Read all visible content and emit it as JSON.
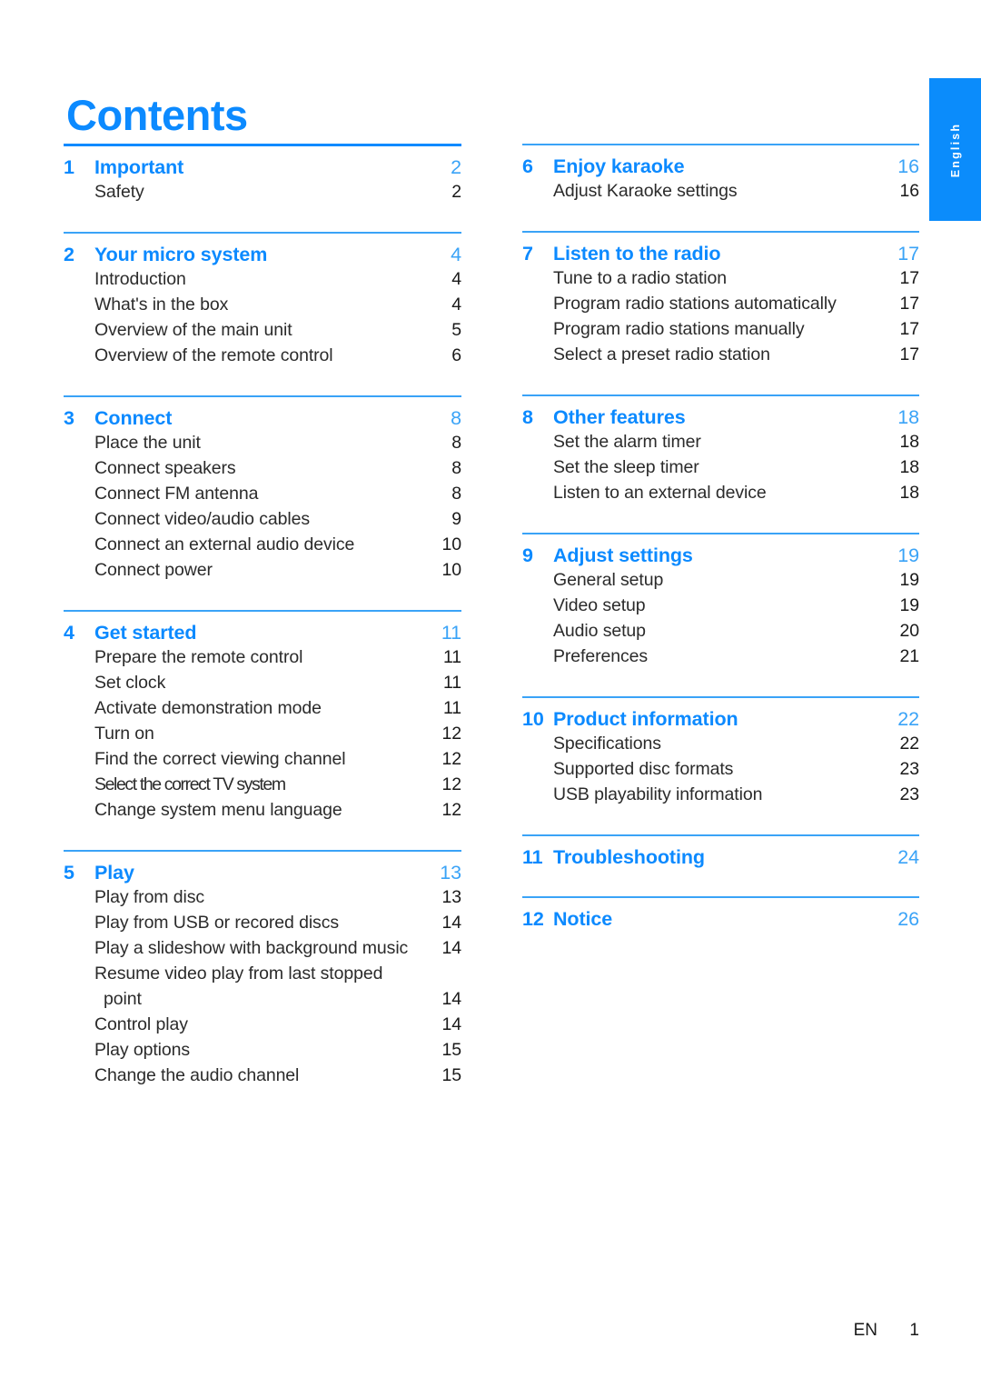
{
  "page": {
    "title": "Contents",
    "language_tab": "English",
    "footer": {
      "locale": "EN",
      "page_number": "1"
    },
    "accent_color": "#0c8aff",
    "rule_color": "#3aa3f7",
    "text_color": "#2b2b2b"
  },
  "columns": [
    {
      "sections": [
        {
          "number": "1",
          "title": "Important",
          "page": "2",
          "rule": "thick",
          "entries": [
            {
              "label": "Safety",
              "page": "2"
            }
          ]
        },
        {
          "number": "2",
          "title": "Your micro system",
          "page": "4",
          "rule": "thin",
          "entries": [
            {
              "label": "Introduction",
              "page": "4"
            },
            {
              "label": "What's in the box",
              "page": "4"
            },
            {
              "label": "Overview of the main unit",
              "page": "5"
            },
            {
              "label": "Overview of the remote control",
              "page": "6"
            }
          ]
        },
        {
          "number": "3",
          "title": "Connect",
          "page": "8",
          "rule": "thin",
          "entries": [
            {
              "label": "Place the unit",
              "page": "8"
            },
            {
              "label": "Connect speakers",
              "page": "8"
            },
            {
              "label": "Connect FM antenna",
              "page": "8"
            },
            {
              "label": "Connect video/audio cables",
              "page": "9"
            },
            {
              "label": "Connect an external audio device",
              "page": "10"
            },
            {
              "label": "Connect power",
              "page": "10"
            }
          ]
        },
        {
          "number": "4",
          "title": "Get started",
          "page": "11",
          "rule": "thin",
          "entries": [
            {
              "label": "Prepare the remote control",
              "page": "11"
            },
            {
              "label": "Set clock",
              "page": "11"
            },
            {
              "label": "Activate demonstration mode",
              "page": "11"
            },
            {
              "label": "Turn on",
              "page": "12"
            },
            {
              "label": "Find the correct viewing channel",
              "page": "12"
            },
            {
              "label": "Select the correct TV system",
              "page": "12",
              "tight": true
            },
            {
              "label": "Change system menu language",
              "page": "12"
            }
          ]
        },
        {
          "number": "5",
          "title": "Play",
          "page": "13",
          "rule": "thin",
          "entries": [
            {
              "label": "Play from disc",
              "page": "13"
            },
            {
              "label": "Play from USB or recored discs",
              "page": "14"
            },
            {
              "label": "Play a slideshow with background music",
              "page": "14"
            },
            {
              "label": "Resume video play from last stopped",
              "page": "",
              "no_page": true
            },
            {
              "label": "point",
              "page": "14",
              "continuation": true
            },
            {
              "label": "Control play",
              "page": "14"
            },
            {
              "label": "Play options",
              "page": "15"
            },
            {
              "label": "Change the audio channel",
              "page": "15"
            }
          ]
        }
      ]
    },
    {
      "sections": [
        {
          "number": "6",
          "title": "Enjoy karaoke",
          "page": "16",
          "rule": "thin",
          "entries": [
            {
              "label": "Adjust Karaoke settings",
              "page": "16"
            }
          ]
        },
        {
          "number": "7",
          "title": "Listen to the radio",
          "page": "17",
          "rule": "thin",
          "entries": [
            {
              "label": "Tune to a radio station",
              "page": "17"
            },
            {
              "label": "Program radio stations automatically",
              "page": "17"
            },
            {
              "label": "Program radio stations manually",
              "page": "17"
            },
            {
              "label": "Select a preset radio station",
              "page": "17"
            }
          ]
        },
        {
          "number": "8",
          "title": "Other features",
          "page": "18",
          "rule": "thin",
          "entries": [
            {
              "label": "Set the alarm timer",
              "page": "18"
            },
            {
              "label": "Set the sleep timer",
              "page": "18"
            },
            {
              "label": "Listen to an external device",
              "page": "18"
            }
          ]
        },
        {
          "number": "9",
          "title": "Adjust settings",
          "page": "19",
          "rule": "thin",
          "entries": [
            {
              "label": "General setup",
              "page": "19"
            },
            {
              "label": "Video setup",
              "page": "19"
            },
            {
              "label": "Audio setup",
              "page": "20"
            },
            {
              "label": "Preferences",
              "page": "21"
            }
          ]
        },
        {
          "number": "10",
          "title": "Product information",
          "page": "22",
          "rule": "thin",
          "entries": [
            {
              "label": "Specifications",
              "page": "22"
            },
            {
              "label": "Supported disc formats",
              "page": "23"
            },
            {
              "label": "USB playability information",
              "page": "23"
            }
          ]
        },
        {
          "number": "11",
          "title": "Troubleshooting",
          "page": "24",
          "rule": "thin",
          "entries": []
        },
        {
          "number": "12",
          "title": "Notice",
          "page": "26",
          "rule": "thin",
          "entries": []
        }
      ]
    }
  ]
}
